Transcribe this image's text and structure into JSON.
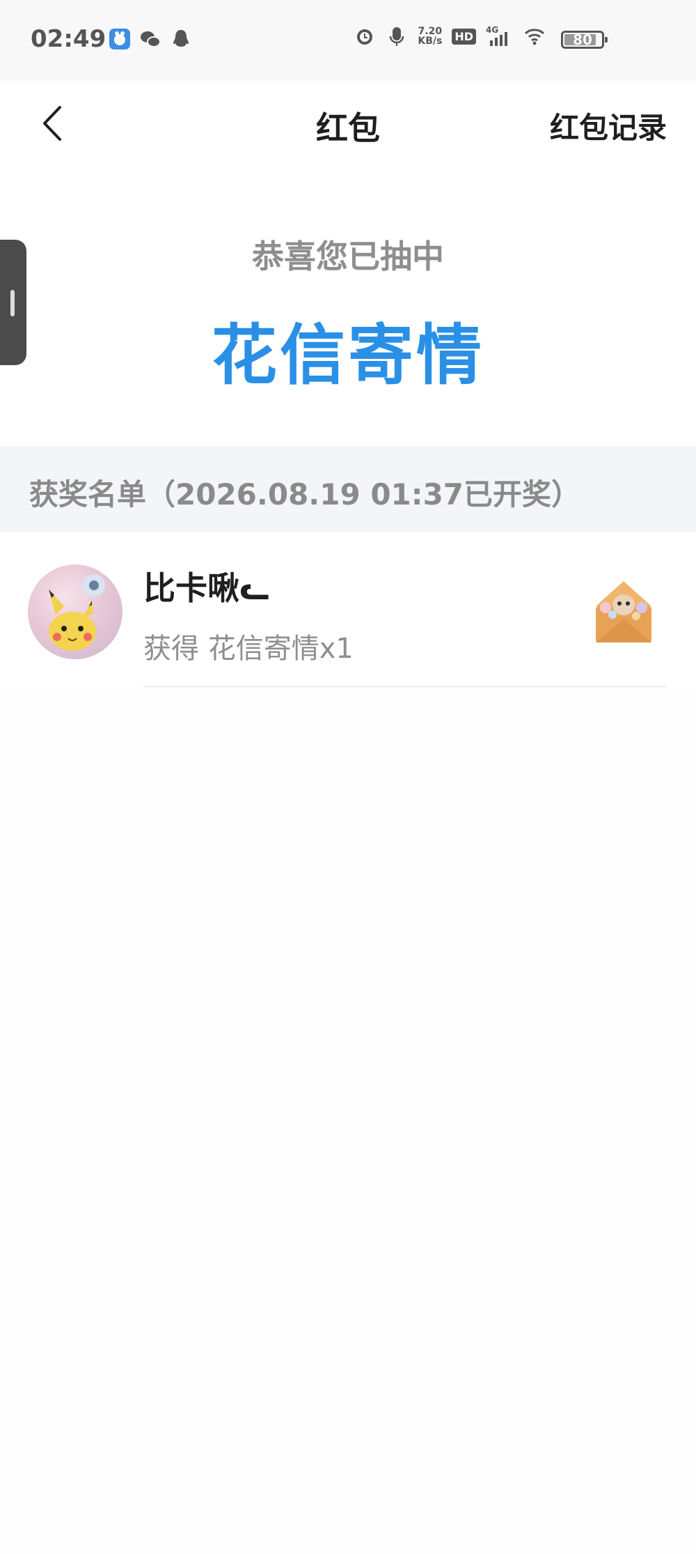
{
  "status_bar": {
    "time": "02:49",
    "net_speed_value": "7.20",
    "net_speed_unit": "KB/s",
    "hd": "HD",
    "network": "4G",
    "battery": "80",
    "left_icons": [
      "baidu-icon",
      "wechat-icon",
      "qq-icon"
    ],
    "right_icons": [
      "alarm-icon",
      "mic-icon",
      "signal-icon",
      "wifi-icon",
      "battery-icon"
    ]
  },
  "nav": {
    "title": "红包",
    "action": "红包记录"
  },
  "hero": {
    "subtitle": "恭喜您已抽中",
    "prize": "花信寄情"
  },
  "list": {
    "header": "获奖名单（2026.08.19 01:37已开奖）",
    "items": [
      {
        "name": "比卡啾ᓚ",
        "prize_text": "获得 花信寄情x1"
      }
    ]
  },
  "colors": {
    "accent": "#2a90e6",
    "muted_text": "#8e8e8e",
    "header_bg": "#f3f5f8"
  }
}
